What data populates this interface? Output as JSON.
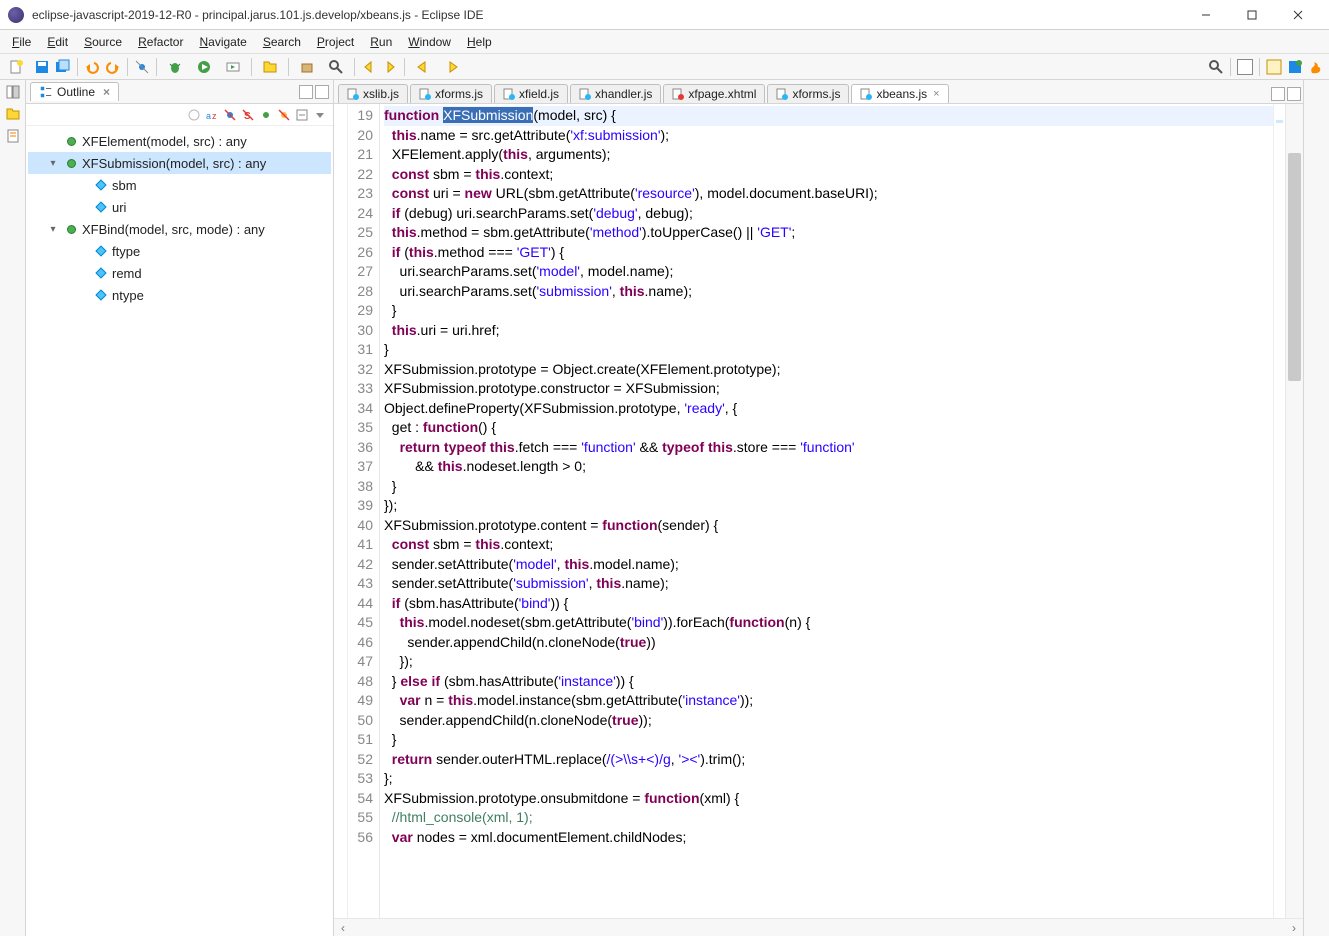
{
  "titlebar": {
    "title": "eclipse-javascript-2019-12-R0 - principal.jarus.101.js.develop/xbeans.js - Eclipse IDE"
  },
  "menu": [
    "File",
    "Edit",
    "Source",
    "Refactor",
    "Navigate",
    "Search",
    "Project",
    "Run",
    "Window",
    "Help"
  ],
  "outline": {
    "tab_label": "Outline",
    "items": [
      {
        "level": 1,
        "kind": "method",
        "label": "XFElement(model, src) : any",
        "expanded": null,
        "selected": false
      },
      {
        "level": 1,
        "kind": "method",
        "label": "XFSubmission(model, src) : any",
        "expanded": true,
        "selected": true
      },
      {
        "level": 2,
        "kind": "field",
        "label": "sbm"
      },
      {
        "level": 2,
        "kind": "field",
        "label": "uri"
      },
      {
        "level": 1,
        "kind": "method",
        "label": "XFBind(model, src, mode) : any",
        "expanded": true,
        "selected": false
      },
      {
        "level": 2,
        "kind": "field",
        "label": "ftype"
      },
      {
        "level": 2,
        "kind": "field",
        "label": "remd"
      },
      {
        "level": 2,
        "kind": "field",
        "label": "ntype"
      }
    ]
  },
  "editor": {
    "tabs": [
      {
        "label": "xslib.js",
        "type": "js",
        "active": false
      },
      {
        "label": "xforms.js",
        "type": "js",
        "active": false
      },
      {
        "label": "xfield.js",
        "type": "js",
        "active": false
      },
      {
        "label": "xhandler.js",
        "type": "js",
        "active": false
      },
      {
        "label": "xfpage.xhtml",
        "type": "xhtml",
        "active": false
      },
      {
        "label": "xforms.js",
        "type": "js",
        "active": false
      },
      {
        "label": "xbeans.js",
        "type": "js",
        "active": true
      }
    ],
    "first_line": 19,
    "lines": [
      {
        "n": 19,
        "hl": true,
        "html": "<span class='kw'>function</span> <span class='sel'>XFSubmission</span>(model, src) {"
      },
      {
        "n": 20,
        "html": "  <span class='kw'>this</span>.name = src.getAttribute(<span class='str'>'xf:submission'</span>);"
      },
      {
        "n": 21,
        "html": "  XFElement.apply(<span class='kw'>this</span>, arguments);"
      },
      {
        "n": 22,
        "html": "  <span class='kw'>const</span> sbm = <span class='kw'>this</span>.context;"
      },
      {
        "n": 23,
        "html": "  <span class='kw'>const</span> uri = <span class='kw'>new</span> URL(sbm.getAttribute(<span class='str'>'resource'</span>), model.document.baseURI);"
      },
      {
        "n": 24,
        "html": "  <span class='kw'>if</span> (debug) uri.searchParams.set(<span class='str'>'debug'</span>, debug);"
      },
      {
        "n": 25,
        "html": "  <span class='kw'>this</span>.method = sbm.getAttribute(<span class='str'>'method'</span>).toUpperCase() || <span class='str'>'GET'</span>;"
      },
      {
        "n": 26,
        "html": "  <span class='kw'>if</span> (<span class='kw'>this</span>.method === <span class='str'>'GET'</span>) {"
      },
      {
        "n": 27,
        "html": "    uri.searchParams.set(<span class='str'>'model'</span>, model.name);"
      },
      {
        "n": 28,
        "html": "    uri.searchParams.set(<span class='str'>'submission'</span>, <span class='kw'>this</span>.name);"
      },
      {
        "n": 29,
        "html": "  }"
      },
      {
        "n": 30,
        "html": "  <span class='kw'>this</span>.uri = uri.href;"
      },
      {
        "n": 31,
        "html": "}"
      },
      {
        "n": 32,
        "html": "XFSubmission.prototype = Object.create(XFElement.prototype);"
      },
      {
        "n": 33,
        "html": "XFSubmission.prototype.constructor = XFSubmission;"
      },
      {
        "n": 34,
        "html": "Object.defineProperty(XFSubmission.prototype, <span class='str'>'ready'</span>, {"
      },
      {
        "n": 35,
        "html": "  get : <span class='kw'>function</span>() {"
      },
      {
        "n": 36,
        "html": "    <span class='kw'>return</span> <span class='kw'>typeof</span> <span class='kw'>this</span>.fetch === <span class='str'>'function'</span> &amp;&amp; <span class='kw'>typeof</span> <span class='kw'>this</span>.store === <span class='str'>'function'</span>"
      },
      {
        "n": 37,
        "html": "        &amp;&amp; <span class='kw'>this</span>.nodeset.length &gt; 0;"
      },
      {
        "n": 38,
        "html": "  }"
      },
      {
        "n": 39,
        "html": "});"
      },
      {
        "n": 40,
        "html": "XFSubmission.prototype.content = <span class='kw'>function</span>(sender) {"
      },
      {
        "n": 41,
        "html": "  <span class='kw'>const</span> sbm = <span class='kw'>this</span>.context;"
      },
      {
        "n": 42,
        "html": "  sender.setAttribute(<span class='str'>'model'</span>, <span class='kw'>this</span>.model.name);"
      },
      {
        "n": 43,
        "html": "  sender.setAttribute(<span class='str'>'submission'</span>, <span class='kw'>this</span>.name);"
      },
      {
        "n": 44,
        "html": "  <span class='kw'>if</span> (sbm.hasAttribute(<span class='str'>'bind'</span>)) {"
      },
      {
        "n": 45,
        "html": "    <span class='kw'>this</span>.model.nodeset(sbm.getAttribute(<span class='str'>'bind'</span>)).forEach(<span class='kw'>function</span>(n) {"
      },
      {
        "n": 46,
        "html": "      sender.appendChild(n.cloneNode(<span class='kw'>true</span>))"
      },
      {
        "n": 47,
        "html": "    });"
      },
      {
        "n": 48,
        "html": "  } <span class='kw'>else</span> <span class='kw'>if</span> (sbm.hasAttribute(<span class='str'>'instance'</span>)) {"
      },
      {
        "n": 49,
        "html": "    <span class='kw'>var</span> n = <span class='kw'>this</span>.model.instance(sbm.getAttribute(<span class='str'>'instance'</span>));"
      },
      {
        "n": 50,
        "html": "    sender.appendChild(n.cloneNode(<span class='kw'>true</span>));"
      },
      {
        "n": 51,
        "html": "  }"
      },
      {
        "n": 52,
        "html": "  <span class='kw'>return</span> sender.outerHTML.replace(<span class='rx'>/(&gt;\\\\s+&lt;)/g</span>, <span class='str'>'&gt;&lt;'</span>).trim();"
      },
      {
        "n": 53,
        "html": "};"
      },
      {
        "n": 54,
        "html": "XFSubmission.prototype.onsubmitdone = <span class='kw'>function</span>(xml) {"
      },
      {
        "n": 55,
        "html": "  <span class='com'>//html_console(xml, 1);</span>"
      },
      {
        "n": 56,
        "html": "  <span class='kw'>var</span> nodes = xml.documentElement.childNodes;"
      }
    ]
  }
}
